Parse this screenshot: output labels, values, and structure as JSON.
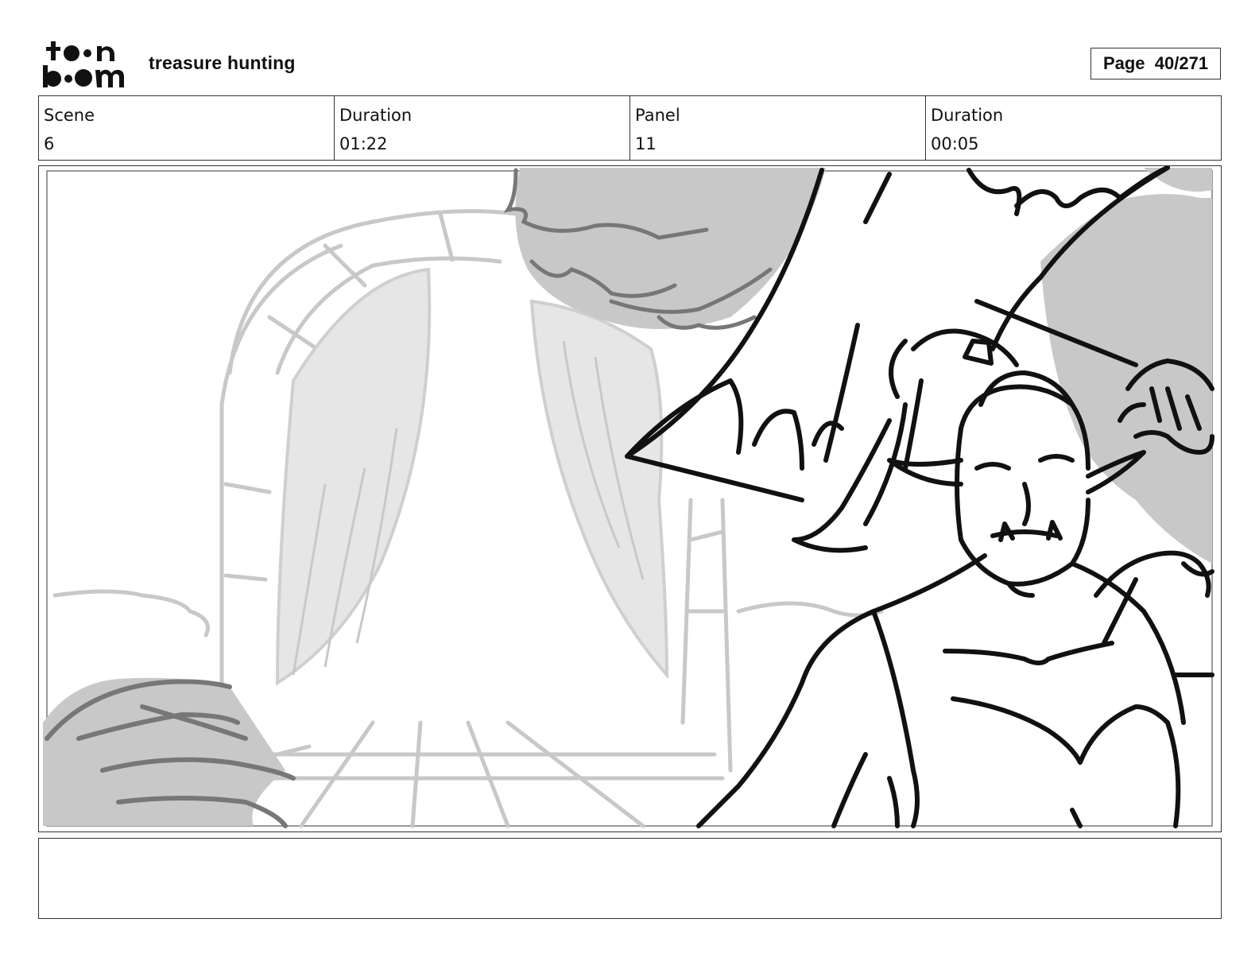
{
  "header": {
    "logo_text_top": "toon",
    "logo_text_bottom": "boom",
    "project_title": "treasure hunting",
    "page_label": "Page",
    "page_value": "40/271"
  },
  "info": {
    "scene_label": "Scene",
    "scene_value": "6",
    "scene_duration_label": "Duration",
    "scene_duration_value": "01:22",
    "panel_label": "Panel",
    "panel_value": "11",
    "panel_duration_label": "Duration",
    "panel_duration_value": "00:05"
  },
  "notes": {
    "text": ""
  }
}
